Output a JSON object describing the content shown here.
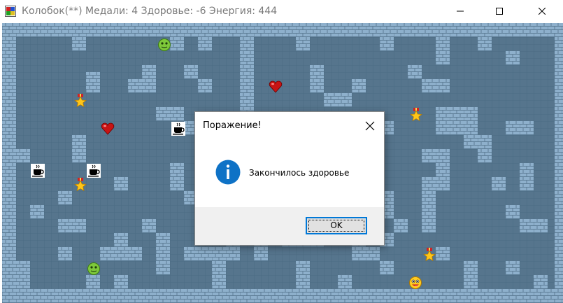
{
  "window": {
    "title": "Колобок(**) Медали: 4 Здоровье: -6 Энергия: 444",
    "controls": [
      "minimize-icon",
      "maximize-icon",
      "close-icon"
    ]
  },
  "game": {
    "status": {
      "medals": 4,
      "health": -6,
      "energy": 444
    },
    "colors": {
      "floor": "#56758d",
      "grid": "#4b6b83",
      "brick": "#8eb0cc",
      "mortar": "#5d7d96"
    },
    "items": [
      {
        "type": "kolobok-icon"
      },
      {
        "type": "heart-icon"
      },
      {
        "type": "medal-icon"
      },
      {
        "type": "medal-icon"
      },
      {
        "type": "heart-icon"
      },
      {
        "type": "coffee-icon"
      },
      {
        "type": "coffee-icon"
      },
      {
        "type": "coffee-icon"
      },
      {
        "type": "medal-icon"
      },
      {
        "type": "medal-icon"
      },
      {
        "type": "kolobok-icon"
      },
      {
        "type": "player-icon"
      }
    ]
  },
  "dialog": {
    "title": "Поражение!",
    "icon": "info-icon",
    "message": "Закончилось здоровье",
    "ok_label": "OK"
  }
}
